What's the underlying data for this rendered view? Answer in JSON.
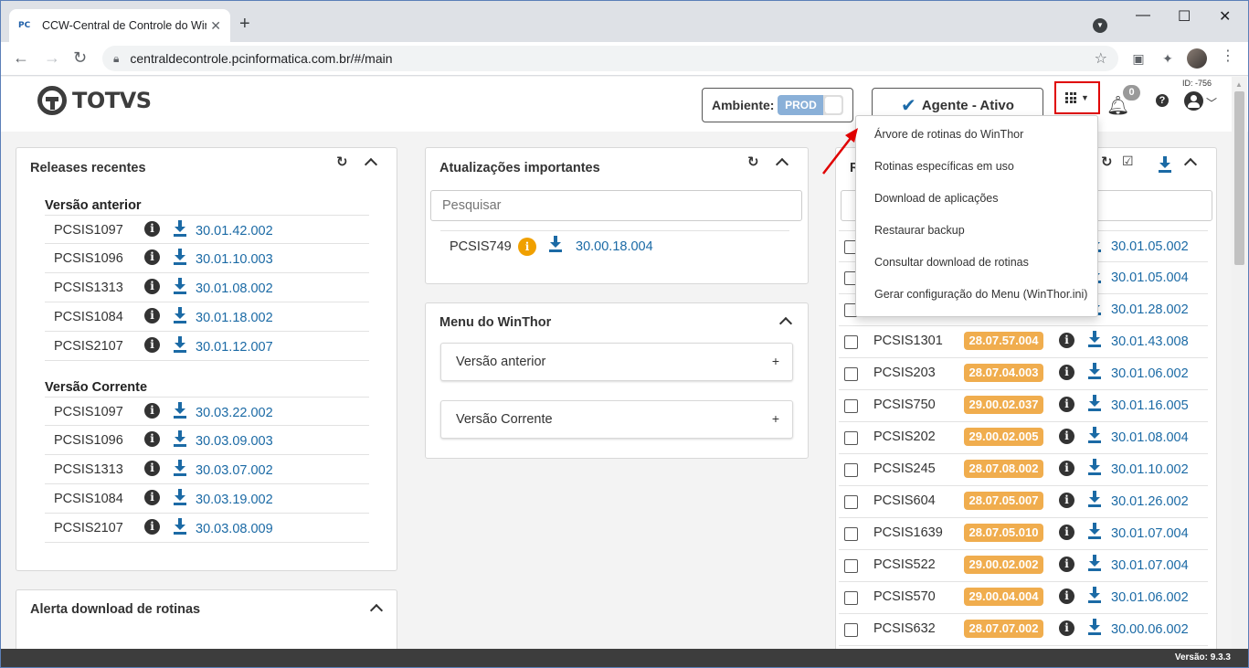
{
  "browser": {
    "tab_title": "CCW-Central de Controle do Win",
    "favicon_text": "PC",
    "url": "centraldecontrole.pcinformatica.com.br/#/main"
  },
  "header": {
    "logo_text": "TOTVS",
    "ambiente_label": "Ambiente:",
    "ambiente_value": "PROD",
    "agente_label": "Agente - Ativo",
    "notifications_count": "0",
    "id_text": "ID: -756"
  },
  "apps_menu": {
    "items": [
      "Árvore de rotinas do WinThor",
      "Rotinas específicas em uso",
      "Download de aplicações",
      "Restaurar backup",
      "Consultar download de rotinas",
      "Gerar configuração do Menu (WinThor.ini)"
    ]
  },
  "releases": {
    "title": "Releases recentes",
    "groups": [
      {
        "title": "Versão anterior",
        "rows": [
          {
            "name": "PCSIS1097",
            "version": "30.01.42.002"
          },
          {
            "name": "PCSIS1096",
            "version": "30.01.10.003"
          },
          {
            "name": "PCSIS1313",
            "version": "30.01.08.002"
          },
          {
            "name": "PCSIS1084",
            "version": "30.01.18.002"
          },
          {
            "name": "PCSIS2107",
            "version": "30.01.12.007"
          }
        ]
      },
      {
        "title": "Versão Corrente",
        "rows": [
          {
            "name": "PCSIS1097",
            "version": "30.03.22.002"
          },
          {
            "name": "PCSIS1096",
            "version": "30.03.09.003"
          },
          {
            "name": "PCSIS1313",
            "version": "30.03.07.002"
          },
          {
            "name": "PCSIS1084",
            "version": "30.03.19.002"
          },
          {
            "name": "PCSIS2107",
            "version": "30.03.08.009"
          }
        ]
      }
    ]
  },
  "alerta": {
    "title": "Alerta download de rotinas"
  },
  "atualizacoes": {
    "title": "Atualizações importantes",
    "search_placeholder": "Pesquisar",
    "rows": [
      {
        "name": "PCSIS749",
        "version": "30.00.18.004"
      }
    ]
  },
  "menu_winthor": {
    "title": "Menu do WinThor",
    "items": [
      "Versão anterior",
      "Versão Corrente"
    ]
  },
  "right_panel": {
    "title_visible": "R",
    "rows": [
      {
        "name": "",
        "badge": "",
        "version": "30.01.05.002"
      },
      {
        "name": "",
        "badge": "",
        "version": "30.01.05.004"
      },
      {
        "name": "",
        "badge": "",
        "version": "30.01.28.002"
      },
      {
        "name": "PCSIS1301",
        "badge": "28.07.57.004",
        "version": "30.01.43.008"
      },
      {
        "name": "PCSIS203",
        "badge": "28.07.04.003",
        "version": "30.01.06.002"
      },
      {
        "name": "PCSIS750",
        "badge": "29.00.02.037",
        "version": "30.01.16.005"
      },
      {
        "name": "PCSIS202",
        "badge": "29.00.02.005",
        "version": "30.01.08.004"
      },
      {
        "name": "PCSIS245",
        "badge": "28.07.08.002",
        "version": "30.01.10.002"
      },
      {
        "name": "PCSIS604",
        "badge": "28.07.05.007",
        "version": "30.01.26.002"
      },
      {
        "name": "PCSIS1639",
        "badge": "28.07.05.010",
        "version": "30.01.07.004"
      },
      {
        "name": "PCSIS522",
        "badge": "29.00.02.002",
        "version": "30.01.07.004"
      },
      {
        "name": "PCSIS570",
        "badge": "29.00.04.004",
        "version": "30.01.06.002"
      },
      {
        "name": "PCSIS632",
        "badge": "28.07.07.002",
        "version": "30.00.06.002"
      }
    ]
  },
  "footer": {
    "version_text": "Versão: 9.3.3"
  },
  "colors": {
    "accent_blue": "#1b6aa5",
    "badge_orange": "#f0ad4e",
    "highlight_red": "#e00000"
  }
}
